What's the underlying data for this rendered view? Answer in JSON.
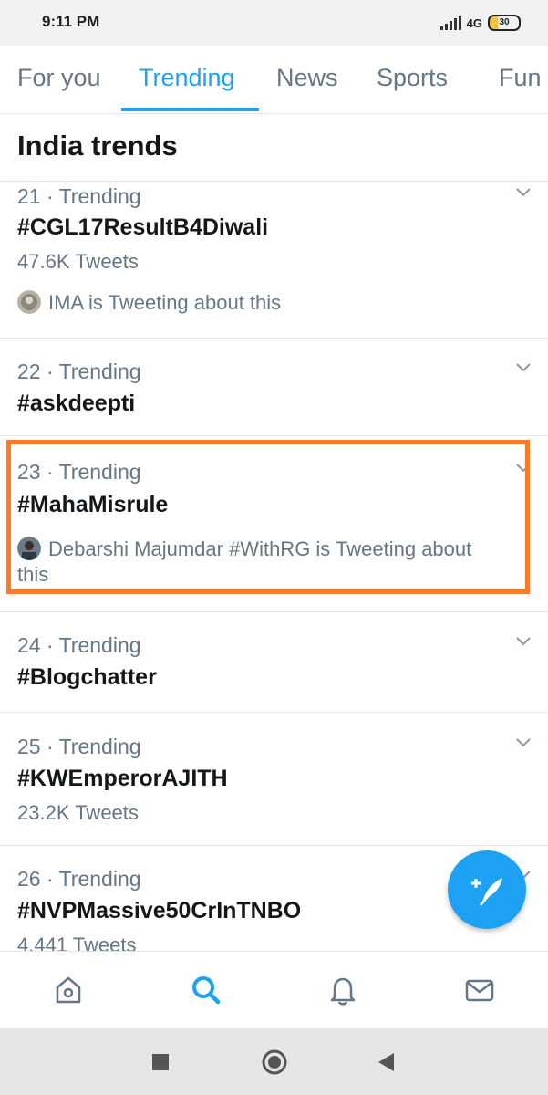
{
  "status_bar": {
    "time": "9:11 PM",
    "network": "4G",
    "battery": "30"
  },
  "tabs": [
    {
      "label": "For you",
      "active": false
    },
    {
      "label": "Trending",
      "active": true
    },
    {
      "label": "News",
      "active": false
    },
    {
      "label": "Sports",
      "active": false
    },
    {
      "label": "Fun",
      "active": false
    }
  ],
  "section": {
    "title": "India trends"
  },
  "trends": [
    {
      "rank": "21 · Trending",
      "name": "#CGL17ResultB4Diwali",
      "count": "47.6K Tweets",
      "context": "IMA is Tweeting about this"
    },
    {
      "rank": "22 · Trending",
      "name": "#askdeepti"
    },
    {
      "rank": "23 · Trending",
      "name": "#MahaMisrule",
      "context_line1": "Debarshi Majumdar #WithRG is Tweeting about",
      "context_line2": "this"
    },
    {
      "rank": "24 · Trending",
      "name": "#Blogchatter"
    },
    {
      "rank": "25 · Trending",
      "name": "#KWEmperorAJITH",
      "count": "23.2K Tweets"
    },
    {
      "rank": "26 · Trending",
      "name": "#NVPMassive50CrInTNBO",
      "count": "4,441 Tweets"
    }
  ],
  "colors": {
    "accent": "#1da1f2",
    "highlight": "#ff7a26",
    "muted": "#657786"
  },
  "icons": {
    "fab": "compose-tweet-icon",
    "nav": [
      "home-icon",
      "search-icon",
      "notifications-icon",
      "messages-icon"
    ],
    "system": [
      "recents-icon",
      "home-circle-icon",
      "back-icon"
    ]
  }
}
